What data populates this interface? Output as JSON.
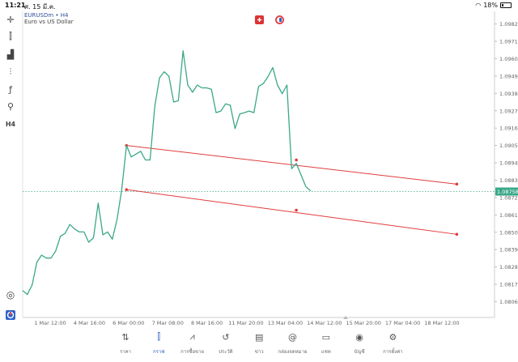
{
  "status_bar": {
    "time": "11:21",
    "date": "ศ. 15 มี.ค.",
    "battery": "18%"
  },
  "symbol": {
    "title": "EURUSDm • H4",
    "description": "Euro vs US Dollar"
  },
  "left_toolbar": {
    "items": [
      {
        "name": "crosshair-icon",
        "glyph": "✛"
      },
      {
        "name": "candlestick-icon",
        "glyph": "⫿"
      },
      {
        "name": "indicators-icon",
        "glyph": "▟"
      },
      {
        "name": "settings-sliders-icon",
        "glyph": "⫶"
      },
      {
        "name": "function-icon",
        "glyph": "ƒ"
      },
      {
        "name": "objects-icon",
        "glyph": "⚲"
      }
    ],
    "timeframe": "H4"
  },
  "price_axis": {
    "ticks": [
      "1.09820",
      "1.09710",
      "1.09600",
      "1.09490",
      "1.09380",
      "1.09270",
      "1.09160",
      "1.09050",
      "1.08940",
      "1.08830",
      "1.08720",
      "1.08610",
      "1.08500",
      "1.08390",
      "1.08280",
      "1.08170",
      "1.08060"
    ],
    "current_price": "1.08758"
  },
  "time_axis": {
    "labels": [
      "1 Mar 12:00",
      "4 Mar 16:00",
      "6 Mar 00:00",
      "7 Mar 08:00",
      "8 Mar 16:00",
      "11 Mar 20:00",
      "13 Mar 04:00",
      "14 Mar 12:00",
      "15 Mar 20:00",
      "17 Mar 04:00",
      "18 Mar 12:00"
    ]
  },
  "chart_data": {
    "type": "line",
    "line_color": "#3aa889",
    "trend_color": "#e03c3c",
    "ylim": [
      1.0796,
      1.099
    ],
    "xlim": [
      0,
      100
    ],
    "series": [
      {
        "points": [
          [
            0,
            1.08131
          ],
          [
            1,
            1.08106
          ],
          [
            2,
            1.08166
          ],
          [
            3,
            1.08309
          ],
          [
            4,
            1.08355
          ],
          [
            5,
            1.08336
          ],
          [
            6,
            1.08336
          ],
          [
            7,
            1.08381
          ],
          [
            8,
            1.08474
          ],
          [
            9,
            1.08493
          ],
          [
            10,
            1.08549
          ],
          [
            11,
            1.08521
          ],
          [
            12,
            1.08502
          ],
          [
            13,
            1.08502
          ],
          [
            14,
            1.08437
          ],
          [
            15,
            1.08465
          ],
          [
            16,
            1.08684
          ],
          [
            17,
            1.08484
          ],
          [
            18,
            1.08502
          ],
          [
            19,
            1.08456
          ],
          [
            20,
            1.08581
          ],
          [
            21,
            1.0877
          ],
          [
            22,
            1.0905
          ],
          [
            23,
            1.08977
          ],
          [
            24,
            1.08995
          ],
          [
            25,
            1.09013
          ],
          [
            26,
            1.08958
          ],
          [
            27,
            1.08958
          ],
          [
            28,
            1.09296
          ],
          [
            29,
            1.09479
          ],
          [
            30,
            1.09517
          ],
          [
            31,
            1.09489
          ],
          [
            32,
            1.09325
          ],
          [
            33,
            1.09334
          ],
          [
            34,
            1.0965
          ],
          [
            35,
            1.09433
          ],
          [
            36,
            1.09387
          ],
          [
            37,
            1.09433
          ],
          [
            38,
            1.09415
          ],
          [
            39,
            1.09415
          ],
          [
            40,
            1.09406
          ],
          [
            41,
            1.09258
          ],
          [
            42,
            1.09268
          ],
          [
            43,
            1.09314
          ],
          [
            44,
            1.09305
          ],
          [
            45,
            1.09157
          ],
          [
            46,
            1.09249
          ],
          [
            47,
            1.09258
          ],
          [
            48,
            1.09268
          ],
          [
            49,
            1.09258
          ],
          [
            50,
            1.09424
          ],
          [
            51,
            1.09442
          ],
          [
            52,
            1.09487
          ],
          [
            53,
            1.09544
          ],
          [
            54,
            1.09433
          ],
          [
            55,
            1.09378
          ],
          [
            56,
            1.09433
          ],
          [
            57,
            1.08903
          ],
          [
            58,
            1.08936
          ],
          [
            59,
            1.08863
          ],
          [
            60,
            1.0879
          ],
          [
            61,
            1.08763
          ]
        ]
      }
    ],
    "trendlines": [
      {
        "from": [
          22,
          1.0905
        ],
        "to": [
          92,
          1.08805
        ],
        "mid": [
          58,
          1.08958
        ]
      },
      {
        "from": [
          22,
          1.0877
        ],
        "to": [
          92,
          1.08487
        ],
        "mid": [
          58,
          1.0864
        ]
      }
    ]
  },
  "bottom_nav": {
    "items": [
      {
        "name": "nav-quotes",
        "icon": "quotes-icon",
        "glyph": "⇅",
        "label": "ราคา"
      },
      {
        "name": "nav-chart",
        "icon": "chart-icon",
        "glyph": "⫿",
        "label": "กราฟ",
        "active": true
      },
      {
        "name": "nav-trade",
        "icon": "trade-icon",
        "glyph": "⩘",
        "label": "การซื้อขาย"
      },
      {
        "name": "nav-history",
        "icon": "history-icon",
        "glyph": "↺",
        "label": "ประวัติ"
      },
      {
        "name": "nav-news",
        "icon": "news-icon",
        "glyph": "▤",
        "label": "ข่าว"
      },
      {
        "name": "nav-mailbox",
        "icon": "mailbox-icon",
        "glyph": "@",
        "label": "กล่องจดหมาย"
      },
      {
        "name": "nav-chat",
        "icon": "chat-icon",
        "glyph": "▭",
        "label": "แชท"
      },
      {
        "name": "nav-account",
        "icon": "account-icon",
        "glyph": "◉",
        "label": "บัญชี"
      },
      {
        "name": "nav-settings",
        "icon": "settings-icon",
        "glyph": "⚙",
        "label": "การตั้งค่า"
      }
    ]
  }
}
